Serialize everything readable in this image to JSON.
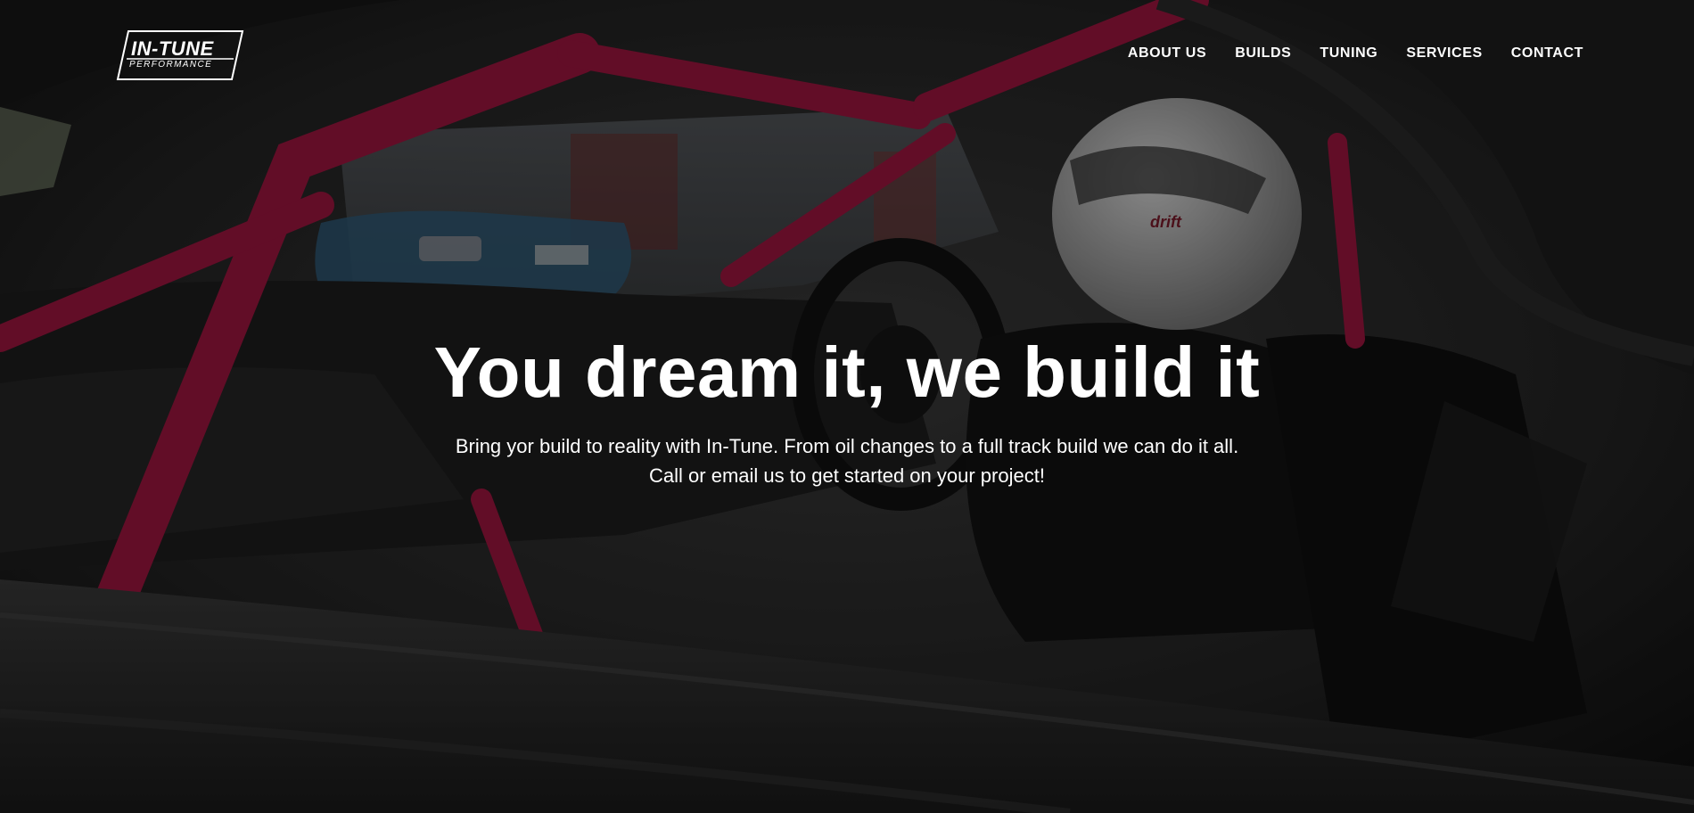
{
  "brand": {
    "name": "IN-TUNE",
    "tagline": "PERFORMANCE"
  },
  "nav": {
    "items": [
      {
        "label": "ABOUT US"
      },
      {
        "label": "BUILDS"
      },
      {
        "label": "TUNING"
      },
      {
        "label": "SERVICES"
      },
      {
        "label": "CONTACT"
      }
    ]
  },
  "hero": {
    "title": "You dream it, we build it",
    "subtitle_line1": "Bring yor build to reality with In-Tune. From oil changes to a full track build we can do it all.",
    "subtitle_line2": "Call or email us to get started on your project!",
    "background_description_icon": "race-car-interior-photo"
  },
  "colors": {
    "text": "#ffffff",
    "roll_cage_accent": "#a3123d",
    "background": "#141414"
  }
}
